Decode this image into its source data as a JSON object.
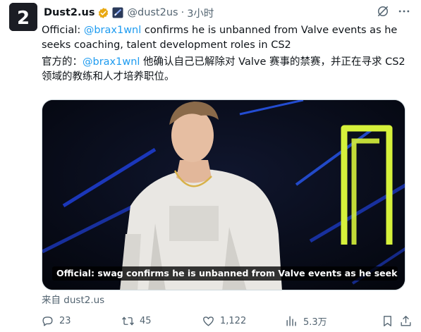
{
  "author": {
    "display_name": "Dust2.us",
    "handle": "@dust2us",
    "separator": "·",
    "time": "3小时",
    "avatar_text": "2",
    "verified_color": "#e8a812"
  },
  "post": {
    "text_en_prefix": "Official: ",
    "text_en_mention": "@brax1wnl",
    "text_en_rest": " confirms he is unbanned from Valve events as he seeks coaching, talent development roles in CS2",
    "text_zh_prefix": "官方的：",
    "text_zh_mention": "@brax1wnl",
    "text_zh_rest": " 他确认自己已解除对 Valve 赛事的禁赛，并正在寻求 CS2 领域的教练和人才培养职位。"
  },
  "media": {
    "caption": "Official: swag confirms he is unbanned from Valve events as he seeks coachin..."
  },
  "source_line": "来自 dust2.us",
  "stats": {
    "replies": "23",
    "retweets": "45",
    "likes": "1,122",
    "views": "5.3万"
  },
  "colors": {
    "accent": "#1d9bf0",
    "muted": "#536471",
    "neon_yellow": "#d6f13b",
    "neon_blue": "#1f3fd6"
  }
}
